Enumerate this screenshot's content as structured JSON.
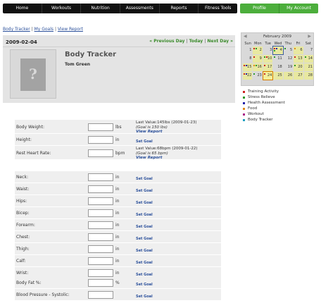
{
  "nav": {
    "main": [
      "Home",
      "Workouts",
      "Nutrition",
      "Assessments",
      "Reports",
      "Fitness Tools"
    ],
    "account": [
      "Profile",
      "My Account"
    ]
  },
  "sublinks": {
    "body_tracker": "Body Tracker",
    "my_goals": "My Goals",
    "view_report": "View Report",
    "sep": "|"
  },
  "header": {
    "date": "2009-02-04",
    "prev_day": "« Previous Day",
    "today": "Today",
    "next_day": "Next Day »",
    "sep": "|",
    "title": "Body Tracker",
    "name": "Tom Green",
    "avatar_glyph": "?"
  },
  "group1": [
    {
      "label": "Body Weight:",
      "unit": "lbs",
      "last": "Last Value:145lbs (2009-01-23)",
      "goal": "(Goal is 150 lbs)",
      "link": "View Report"
    },
    {
      "label": "Height:",
      "unit": "in",
      "link": "Set Goal"
    },
    {
      "label": "Rest Heart Rate:",
      "unit": "bpm",
      "last": "Last Value:68bpm (2009-01-22)",
      "goal": "(Goal is 65 bpm)",
      "link": "View Report"
    }
  ],
  "group2": [
    {
      "label": "Neck:",
      "unit": "in",
      "link": "Set Goal"
    },
    {
      "label": "Waist:",
      "unit": "in",
      "link": "Set Goal"
    },
    {
      "label": "Hips:",
      "unit": "in",
      "link": "Set Goal"
    },
    {
      "label": "Bicep:",
      "unit": "in",
      "link": "Set Goal"
    },
    {
      "label": "Forearm:",
      "unit": "in",
      "link": "Set Goal"
    },
    {
      "label": "Chest:",
      "unit": "in",
      "link": "Set Goal"
    },
    {
      "label": "Thigh:",
      "unit": "in",
      "link": "Set Goal"
    },
    {
      "label": "Calf:",
      "unit": "in",
      "link": "Set Goal"
    },
    {
      "label": "Wrist:",
      "unit": "in",
      "link": "Set Goal"
    }
  ],
  "group3": [
    {
      "label": "Body Fat %:",
      "unit": "%",
      "link": "Set Goal"
    },
    {
      "label": "Blood Pressure - Systolic:",
      "unit": "",
      "link": "Set Goal"
    }
  ],
  "calendar": {
    "month": "February 2009",
    "prev": "◀",
    "next": "▶",
    "dow": [
      "Sun",
      "Mon",
      "Tue",
      "Wed",
      "Thu",
      "Fri",
      "Sat"
    ],
    "days": [
      {
        "d": "1",
        "hl": false,
        "m": []
      },
      {
        "d": "2",
        "hl": true,
        "m": [
          "#cc2222",
          "#2a9a2a"
        ]
      },
      {
        "d": "3",
        "hl": false,
        "m": []
      },
      {
        "d": "4",
        "hl": true,
        "sel": true,
        "m": [
          "#cc2222",
          "#2222aa",
          "#2a9a2a"
        ]
      },
      {
        "d": "5",
        "hl": false,
        "m": [
          "#2a9a2a"
        ]
      },
      {
        "d": "6",
        "hl": true,
        "m": [
          "#e08a1a"
        ]
      },
      {
        "d": "7",
        "hl": false,
        "m": []
      },
      {
        "d": "8",
        "hl": false,
        "m": []
      },
      {
        "d": "9",
        "hl": true,
        "m": [
          "#cc2222"
        ]
      },
      {
        "d": "10",
        "hl": true,
        "m": [
          "#2a9a2a",
          "#cc2222"
        ]
      },
      {
        "d": "11",
        "hl": false,
        "m": [
          "#2a9a2a"
        ]
      },
      {
        "d": "12",
        "hl": false,
        "m": []
      },
      {
        "d": "13",
        "hl": true,
        "m": [
          "#cc2222"
        ]
      },
      {
        "d": "14",
        "hl": true,
        "m": [
          "#2a9a2a"
        ]
      },
      {
        "d": "15",
        "hl": true,
        "m": [
          "#cc2222",
          "#2222aa"
        ]
      },
      {
        "d": "16",
        "hl": true,
        "m": [
          "#e08a1a",
          "#2a9a2a"
        ]
      },
      {
        "d": "17",
        "hl": true,
        "m": [
          "#cc2222"
        ]
      },
      {
        "d": "18",
        "hl": false,
        "m": []
      },
      {
        "d": "19",
        "hl": false,
        "m": []
      },
      {
        "d": "20",
        "hl": true,
        "m": [
          "#2a9a2a"
        ]
      },
      {
        "d": "21",
        "hl": true,
        "m": []
      },
      {
        "d": "22",
        "hl": true,
        "m": [
          "#cc2222",
          "#2222aa"
        ]
      },
      {
        "d": "23",
        "hl": false,
        "m": [
          "#2a9a2a"
        ]
      },
      {
        "d": "24",
        "hl": true,
        "today": true,
        "m": [
          "#cc2222"
        ]
      },
      {
        "d": "25",
        "hl": true,
        "m": []
      },
      {
        "d": "26",
        "hl": true,
        "m": []
      },
      {
        "d": "27",
        "hl": true,
        "m": []
      },
      {
        "d": "28",
        "hl": true,
        "m": []
      }
    ]
  },
  "legend": [
    {
      "label": "Training Activity",
      "color": "#cc2222"
    },
    {
      "label": "Stress Relieve",
      "color": "#2a9a2a"
    },
    {
      "label": "Health Assessment",
      "color": "#2222aa"
    },
    {
      "label": "Food",
      "color": "#e08a1a"
    },
    {
      "label": "Workout",
      "color": "#aa2288"
    },
    {
      "label": "Body Tracker",
      "color": "#20a0c0"
    }
  ]
}
